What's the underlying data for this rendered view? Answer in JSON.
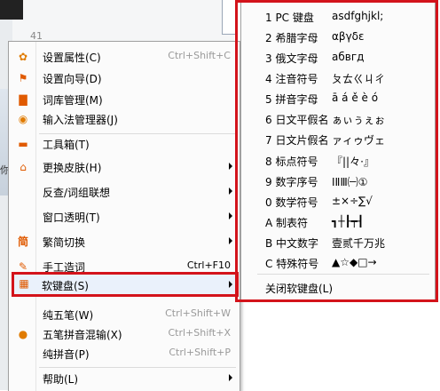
{
  "background": {
    "count": "41",
    "edge_text": "你"
  },
  "menu": {
    "items": [
      {
        "label": "设置属性(C)",
        "shortcut": "Ctrl+Shift+C",
        "icon": "gear-icon",
        "glyph": "✿",
        "color": "#e07b00"
      },
      {
        "label": "设置向导(D)",
        "shortcut": "",
        "icon": "flag-icon",
        "glyph": "⚑",
        "color": "#e05a00"
      },
      {
        "label": "词库管理(M)",
        "shortcut": "",
        "icon": "book-icon",
        "glyph": "▇",
        "color": "#e05a00"
      },
      {
        "label": "输入法管理器(J)",
        "shortcut": "",
        "icon": "manager-icon",
        "glyph": "◉",
        "color": "#e07b00"
      },
      {
        "label": "工具箱(T)",
        "shortcut": "",
        "icon": "toolbox-icon",
        "glyph": "▬",
        "color": "#e05a00"
      },
      {
        "label": "更换皮肤(H)",
        "shortcut": "",
        "icon": "shirt-icon",
        "glyph": "⌂",
        "color": "#e05a00",
        "submenu": true
      },
      {
        "label": "反查/词组联想",
        "shortcut": "",
        "icon": "",
        "glyph": "",
        "color": "",
        "submenu": true
      },
      {
        "label": "窗口透明(T)",
        "shortcut": "",
        "icon": "",
        "glyph": "",
        "color": "",
        "submenu": true
      },
      {
        "label": "繁简切换",
        "shortcut": "",
        "icon": "fan-jian-icon",
        "glyph": "简",
        "color": "#e05a00",
        "submenu": true
      },
      {
        "label": "手工造词",
        "shortcut": "Ctrl+F10",
        "icon": "edit-icon",
        "glyph": "✎",
        "color": "#e05a00"
      },
      {
        "label": "软键盘(S)",
        "shortcut": "",
        "icon": "keyboard-icon",
        "glyph": "▦",
        "color": "#e05a00",
        "submenu": true
      },
      {
        "label": "纯五笔(W)",
        "shortcut": "Ctrl+Shift+W",
        "icon": "",
        "glyph": "",
        "color": ""
      },
      {
        "label": "五笔拼音混输(X)",
        "shortcut": "Ctrl+Shift+X",
        "icon": "radio-dot-icon",
        "glyph": "●",
        "color": "#e07b00"
      },
      {
        "label": "纯拼音(P)",
        "shortcut": "Ctrl+Shift+P",
        "icon": "",
        "glyph": "",
        "color": ""
      },
      {
        "label": "帮助(L)",
        "shortcut": "",
        "icon": "",
        "glyph": "",
        "color": "",
        "submenu": true
      }
    ]
  },
  "soft_keyboard_menu": {
    "items": [
      {
        "label": "1 PC 键盘",
        "sample": "asdfghjkl;"
      },
      {
        "label": "2 希腊字母",
        "sample": "αβγδε"
      },
      {
        "label": "3 俄文字母",
        "sample": "абвгд"
      },
      {
        "label": "4 注音符号",
        "sample": "ㄆㄊㄍㄐㄔ"
      },
      {
        "label": "5 拼音字母",
        "sample": "ā á ě è ó"
      },
      {
        "label": "6 日文平假名",
        "sample": "ぁぃぅぇぉ"
      },
      {
        "label": "7 日文片假名",
        "sample": "ァィゥヴェ"
      },
      {
        "label": "8 标点符号",
        "sample": "『||々·』"
      },
      {
        "label": "9 数字序号",
        "sample": "ⅠⅡⅢ㈠①"
      },
      {
        "label": "0 数学符号",
        "sample": "±×÷∑√"
      },
      {
        "label": "A 制表符",
        "sample": "┓┼┠┯┨"
      },
      {
        "label": "B 中文数字",
        "sample": "壹贰千万兆"
      },
      {
        "label": "C 特殊符号",
        "sample": "▲☆◆□→"
      }
    ],
    "close_label": "关闭软键盘(L)"
  },
  "colors": {
    "highlight_border": "#d3131b",
    "icon_orange": "#e05a00"
  }
}
